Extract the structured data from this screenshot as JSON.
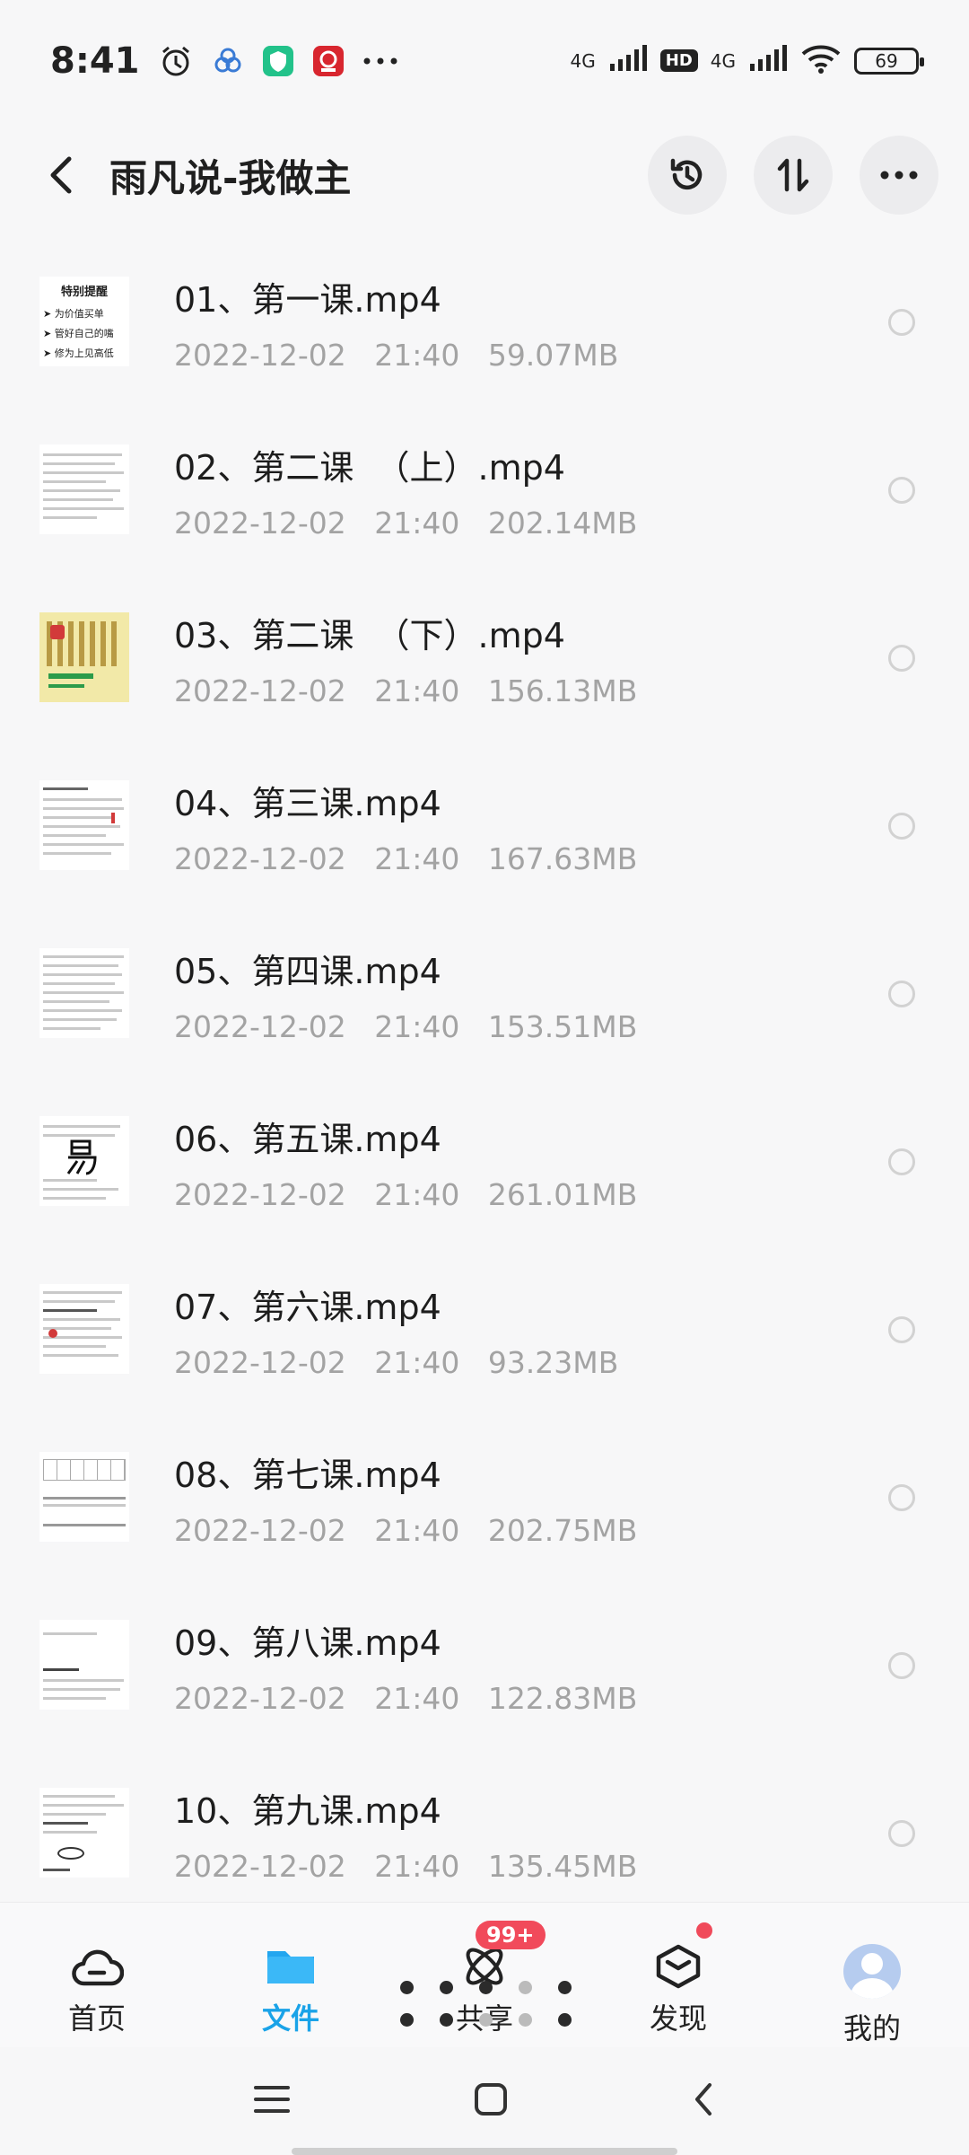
{
  "status_bar": {
    "time": "8:41",
    "network1": "4G",
    "hd": "HD",
    "network2": "4G",
    "battery": "69"
  },
  "header": {
    "title": "雨凡说-我做主",
    "icons": [
      "back-arrow-icon",
      "history-clock-icon",
      "sort-icon",
      "more-icon"
    ]
  },
  "files": [
    {
      "name": "01、第一课.mp4",
      "meta": "2022-12-02   21:40   59.07MB"
    },
    {
      "name": "02、第二课  （上）.mp4",
      "meta": "2022-12-02   21:40   202.14MB"
    },
    {
      "name": "03、第二课  （下）.mp4",
      "meta": "2022-12-02   21:40   156.13MB"
    },
    {
      "name": "04、第三课.mp4",
      "meta": "2022-12-02   21:40   167.63MB"
    },
    {
      "name": "05、第四课.mp4",
      "meta": "2022-12-02   21:40   153.51MB"
    },
    {
      "name": "06、第五课.mp4",
      "meta": "2022-12-02   21:40   261.01MB"
    },
    {
      "name": "07、第六课.mp4",
      "meta": "2022-12-02   21:40   93.23MB"
    },
    {
      "name": "08、第七课.mp4",
      "meta": "2022-12-02   21:40   202.75MB"
    },
    {
      "name": "09、第八课.mp4",
      "meta": "2022-12-02   21:40   122.83MB"
    },
    {
      "name": "10、第九课.mp4",
      "meta": "2022-12-02   21:40   135.45MB"
    }
  ],
  "thumb1_lines": [
    "特别提醒",
    "➤ 为价值买单",
    "➤ 管好自己的嘴",
    "➤ 修为上见高低"
  ],
  "bottom_nav": [
    {
      "label": "首页"
    },
    {
      "label": "文件"
    },
    {
      "label": "共享"
    },
    {
      "label": "发现"
    },
    {
      "label": "我的"
    }
  ],
  "share_badge": "99+",
  "colors": {
    "accent": "#1aa3e8",
    "badge": "#f14a5b"
  }
}
